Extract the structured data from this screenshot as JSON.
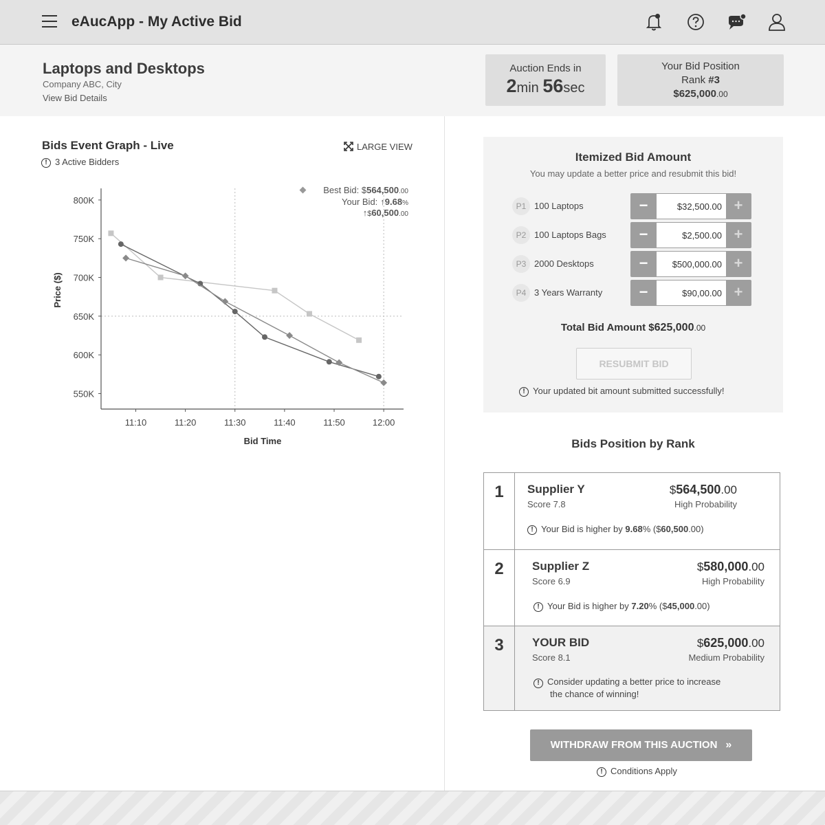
{
  "app": {
    "title": "eAucApp - My Active Bid"
  },
  "header": {
    "project_title": "Laptops and Desktops",
    "company": "Company ABC, City",
    "details_link": "View Bid Details",
    "auction_ends_label": "Auction Ends in",
    "time_min": "2",
    "time_min_unit": "min",
    "time_sec": "56",
    "time_sec_unit": "sec",
    "position_label": "Your Bid Position",
    "rank_prefix": "Rank ",
    "rank_value": "#3",
    "amount_main": "$625,000",
    "amount_dec": ".00"
  },
  "graph": {
    "title": "Bids Event Graph - Live",
    "active_bidders": "3 Active Bidders",
    "large_view": "LARGE VIEW",
    "best_bid_label": "Best Bid: $",
    "best_bid_value": "564,500",
    "best_bid_dec": ".00",
    "your_bid_label": "Your Bid:",
    "your_bid_pct": "9.68",
    "your_bid_pct_unit": "%",
    "your_bid_amt_prefix": "$",
    "your_bid_amt": "60,500",
    "your_bid_amt_dec": ".00"
  },
  "chart_data": {
    "type": "line",
    "xlabel": "Bid Time",
    "ylabel": "Price ($)",
    "x_ticks": [
      "11:10",
      "11:20",
      "11:30",
      "11:40",
      "11:50",
      "12:00"
    ],
    "y_ticks": [
      "550K",
      "600K",
      "650K",
      "700K",
      "750K",
      "800K"
    ],
    "xlim": [
      "11:03",
      "12:04"
    ],
    "ylim": [
      530,
      815
    ],
    "grid": "dashed reference lines at 11:30, 12:00 and 650K",
    "series": [
      {
        "marker": "square",
        "color": "#c6c6c6",
        "points": [
          [
            "11:05",
            757
          ],
          [
            "11:15",
            700
          ],
          [
            "11:38",
            683
          ],
          [
            "11:45",
            653
          ],
          [
            "11:55",
            619
          ]
        ]
      },
      {
        "marker": "circle",
        "color": "#666666",
        "points": [
          [
            "11:07",
            743
          ],
          [
            "11:23",
            692
          ],
          [
            "11:30",
            656
          ],
          [
            "11:36",
            623
          ],
          [
            "11:49",
            591
          ],
          [
            "11:59",
            572
          ]
        ]
      },
      {
        "marker": "diamond",
        "color": "#8a8a8a",
        "points": [
          [
            "11:08",
            725
          ],
          [
            "11:20",
            702
          ],
          [
            "11:28",
            669
          ],
          [
            "11:41",
            625
          ],
          [
            "11:51",
            590
          ],
          [
            "12:00",
            564
          ]
        ]
      }
    ]
  },
  "itemized": {
    "title": "Itemized Bid Amount",
    "subtitle": "You may update a better price and resubmit this bid!",
    "items": [
      {
        "code": "P1",
        "name": "100 Laptops",
        "value": "$32,500.00"
      },
      {
        "code": "P2",
        "name": "100 Laptops Bags",
        "value": "$2,500.00"
      },
      {
        "code": "P3",
        "name": "2000 Desktops",
        "value": "$500,000.00"
      },
      {
        "code": "P4",
        "name": "3 Years Warranty",
        "value": "$90,00.00"
      }
    ],
    "total_label": "Total Bid Amount $",
    "total_value": "625,000",
    "total_dec": ".00",
    "resubmit_label": "RESUBMIT BID",
    "success_msg": "Your updated bit amount submitted successfully!"
  },
  "ranking": {
    "title": "Bids Position by Rank",
    "rows": [
      {
        "rank": "1",
        "name": "Supplier Y",
        "score": "Score 7.8",
        "amount": "564,500",
        "dec": ".00",
        "probability": "High Probability",
        "note_prefix": "Your Bid is higher by ",
        "note_pct": "9.68",
        "note_mid": "% ($",
        "note_amt": "60,500",
        "note_suffix": ".00)"
      },
      {
        "rank": "2",
        "name": "Supplier Z",
        "score": "Score 6.9",
        "amount": "580,000",
        "dec": ".00",
        "probability": "High Probability",
        "note_prefix": "Your Bid is higher by ",
        "note_pct": "7.20",
        "note_mid": "% ($",
        "note_amt": "45,000",
        "note_suffix": ".00)"
      },
      {
        "rank": "3",
        "name": "YOUR BID",
        "score": "Score 8.1",
        "amount": "625,000",
        "dec": ".00",
        "probability": "Medium Probability",
        "note_line1": "Consider updating a better price to increase",
        "note_line2": "the chance of winning!"
      }
    ],
    "currency": "$"
  },
  "withdraw": {
    "label": "WITHDRAW FROM THIS AUCTION",
    "conditions": "Conditions Apply"
  }
}
